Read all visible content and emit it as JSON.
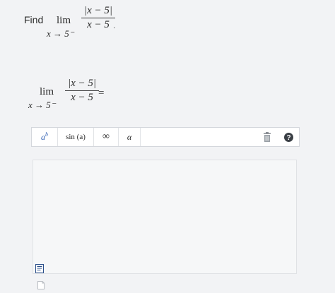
{
  "problem": {
    "prompt_word": "Find",
    "lim": "lim",
    "subscript": "x → 5⁻",
    "numerator": "|x − 5|",
    "denominator": "x − 5",
    "trailing": "."
  },
  "answer_line": {
    "lim": "lim",
    "subscript": "x → 5⁻",
    "numerator": "|x − 5|",
    "denominator": "x − 5",
    "equals": "="
  },
  "toolbar": {
    "power_base": "a",
    "power_exp": "b",
    "sin_label": "sin (a)",
    "infinity": "∞",
    "alpha": "α"
  },
  "icons": [
    "power-template-icon",
    "sine-template-icon",
    "infinity-icon",
    "alpha-icon",
    "trash-icon",
    "help-icon",
    "document-icon",
    "page-icon"
  ]
}
